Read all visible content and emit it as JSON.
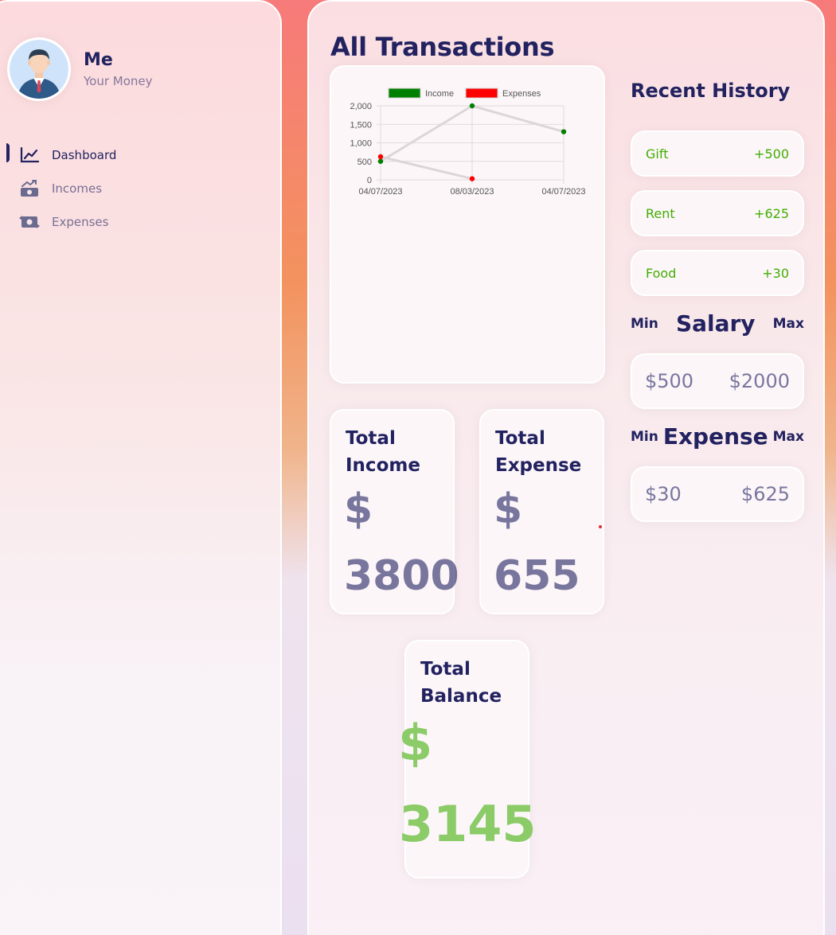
{
  "profile": {
    "name": "Me",
    "subtitle": "Your Money"
  },
  "menu": [
    {
      "label": "Dashboard",
      "icon": "chart-line-icon",
      "active": true
    },
    {
      "label": "Incomes",
      "icon": "money-bill-trend-up-icon",
      "active": false
    },
    {
      "label": "Expenses",
      "icon": "money-bill-transfer-icon",
      "active": false
    }
  ],
  "main": {
    "title": "All Transactions"
  },
  "chart_data": {
    "type": "line",
    "categories": [
      "04/07/2023",
      "08/03/2023",
      "04/07/2023"
    ],
    "series": [
      {
        "name": "Income",
        "values": [
          500,
          2000,
          1300
        ],
        "color": "#008000"
      },
      {
        "name": "Expenses",
        "values": [
          625,
          30
        ],
        "color": "#ff0000"
      }
    ],
    "yticks": [
      "2,000",
      "1,500",
      "1,000",
      "500",
      "0"
    ],
    "ylim": [
      0,
      2000
    ],
    "grid": true,
    "legend": "top"
  },
  "totals": {
    "income": {
      "title": "Total Income",
      "symbol": "$",
      "value": "3800"
    },
    "expense": {
      "title": "Total Expense",
      "symbol": "$",
      "value": "655"
    },
    "balance": {
      "title": "Total Balance",
      "symbol": "$",
      "value": "3145"
    }
  },
  "history": {
    "title": "Recent History",
    "items": [
      {
        "label": "Gift",
        "amount": "+500"
      },
      {
        "label": "Rent",
        "amount": "+625"
      },
      {
        "label": "Food",
        "amount": "+30"
      }
    ]
  },
  "salary": {
    "title": "Salary",
    "min_label": "Min",
    "max_label": "Max",
    "min": "$500",
    "max": "$2000"
  },
  "expense_range": {
    "title": "Expense",
    "min_label": "Min",
    "max_label": "Max",
    "min": "$30",
    "max": "$625"
  },
  "colors": {
    "primary": "#222260",
    "income_green": "#42ad00",
    "balance_green": "#8bcb68",
    "accent_red": "#ff0000"
  }
}
